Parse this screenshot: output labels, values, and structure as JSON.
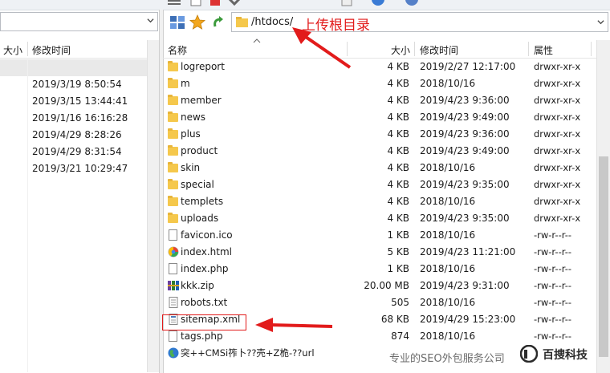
{
  "left_pane": {
    "headers": {
      "size": "大小",
      "modified": "修改时间"
    },
    "rows": [
      {
        "modified": ""
      },
      {
        "modified": "2019/3/19 8:50:54"
      },
      {
        "modified": "2019/3/15 13:44:41"
      },
      {
        "modified": "2019/1/16 16:16:28"
      },
      {
        "modified": "2019/4/29 8:28:26"
      },
      {
        "modified": "2019/4/29 8:31:54"
      },
      {
        "modified": "2019/3/21 10:29:47"
      }
    ]
  },
  "right_pane": {
    "path": "/htdocs/",
    "annotation": "上传根目录",
    "headers": {
      "name": "名称",
      "size": "大小",
      "modified": "修改时间",
      "attributes": "属性"
    },
    "rows": [
      {
        "name": "logreport",
        "type": "folder",
        "size": "4 KB",
        "modified": "2019/2/27 12:17:00",
        "attr": "drwxr-xr-x"
      },
      {
        "name": "m",
        "type": "folder",
        "size": "4 KB",
        "modified": "2018/10/16",
        "attr": "drwxr-xr-x"
      },
      {
        "name": "member",
        "type": "folder",
        "size": "4 KB",
        "modified": "2019/4/23 9:36:00",
        "attr": "drwxr-xr-x"
      },
      {
        "name": "news",
        "type": "folder",
        "size": "4 KB",
        "modified": "2019/4/23 9:49:00",
        "attr": "drwxr-xr-x"
      },
      {
        "name": "plus",
        "type": "folder",
        "size": "4 KB",
        "modified": "2019/4/23 9:36:00",
        "attr": "drwxr-xr-x"
      },
      {
        "name": "product",
        "type": "folder",
        "size": "4 KB",
        "modified": "2019/4/23 9:49:00",
        "attr": "drwxr-xr-x"
      },
      {
        "name": "skin",
        "type": "folder",
        "size": "4 KB",
        "modified": "2018/10/16",
        "attr": "drwxr-xr-x"
      },
      {
        "name": "special",
        "type": "folder",
        "size": "4 KB",
        "modified": "2019/4/23 9:35:00",
        "attr": "drwxr-xr-x"
      },
      {
        "name": "templets",
        "type": "folder",
        "size": "4 KB",
        "modified": "2018/10/16",
        "attr": "drwxr-xr-x"
      },
      {
        "name": "uploads",
        "type": "folder",
        "size": "4 KB",
        "modified": "2019/4/23 9:35:00",
        "attr": "drwxr-xr-x"
      },
      {
        "name": "favicon.ico",
        "type": "file",
        "size": "1 KB",
        "modified": "2018/10/16",
        "attr": "-rw-r--r--"
      },
      {
        "name": "index.html",
        "type": "html",
        "size": "5 KB",
        "modified": "2019/4/23 11:21:00",
        "attr": "-rw-r--r--"
      },
      {
        "name": "index.php",
        "type": "file",
        "size": "1 KB",
        "modified": "2018/10/16",
        "attr": "-rw-r--r--"
      },
      {
        "name": "kkk.zip",
        "type": "zip",
        "size": "20.00 MB",
        "modified": "2019/4/23 9:31:00",
        "attr": "-rw-r--r--"
      },
      {
        "name": "robots.txt",
        "type": "text",
        "size": "505",
        "modified": "2018/10/16",
        "attr": "-rw-r--r--"
      },
      {
        "name": "sitemap.xml",
        "type": "xml",
        "size": "68 KB",
        "modified": "2019/4/29 15:23:00",
        "attr": "-rw-r--r--"
      },
      {
        "name": "tags.php",
        "type": "file",
        "size": "874",
        "modified": "2018/10/16",
        "attr": "-rw-r--r--"
      },
      {
        "name": "突++CMSi筰卜??壳+Z桅-??url",
        "type": "url",
        "size": "",
        "modified": "",
        "attr": ""
      }
    ]
  },
  "watermark": {
    "text": "专业的SEO外包服务公司",
    "brand": "百捜科技"
  },
  "colors": {
    "annotation_red": "#e21b1b",
    "folder": "#f5c84c",
    "selected_row": "#e9e9e9"
  }
}
